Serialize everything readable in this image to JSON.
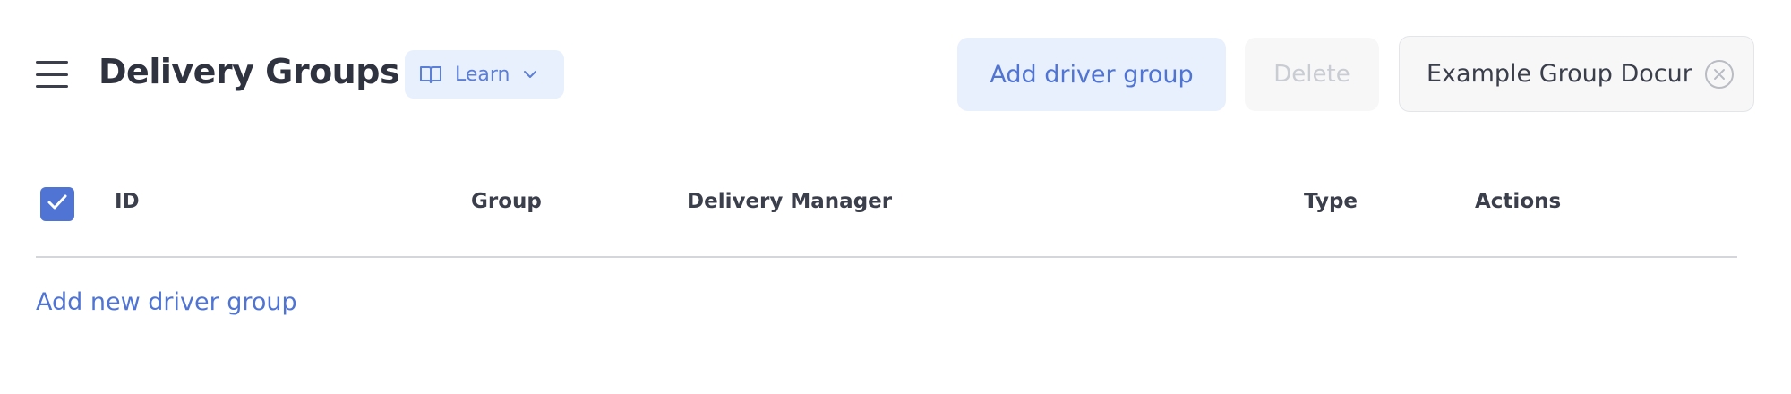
{
  "header": {
    "title": "Delivery Groups",
    "learn_label": "Learn"
  },
  "toolbar": {
    "add_group_label": "Add driver group",
    "delete_label": "Delete",
    "document_value": "Example Group Document"
  },
  "table": {
    "select_all_checked": true,
    "columns": [
      "ID",
      "Group",
      "Delivery Manager",
      "Type",
      "Actions"
    ]
  },
  "footer": {
    "add_row_label": "Add new driver group"
  },
  "icons": {
    "menu": "hamburger-menu-icon",
    "learn": "book-icon",
    "learn_dropdown": "chevron-down-icon",
    "clear": "clear-circle-icon",
    "checkbox": "checkmark-icon"
  },
  "colors": {
    "accent": "#4f74d3",
    "accent_light": "#e8f0fd",
    "text": "#2f3340",
    "disabled_text": "#c9ccd2"
  }
}
